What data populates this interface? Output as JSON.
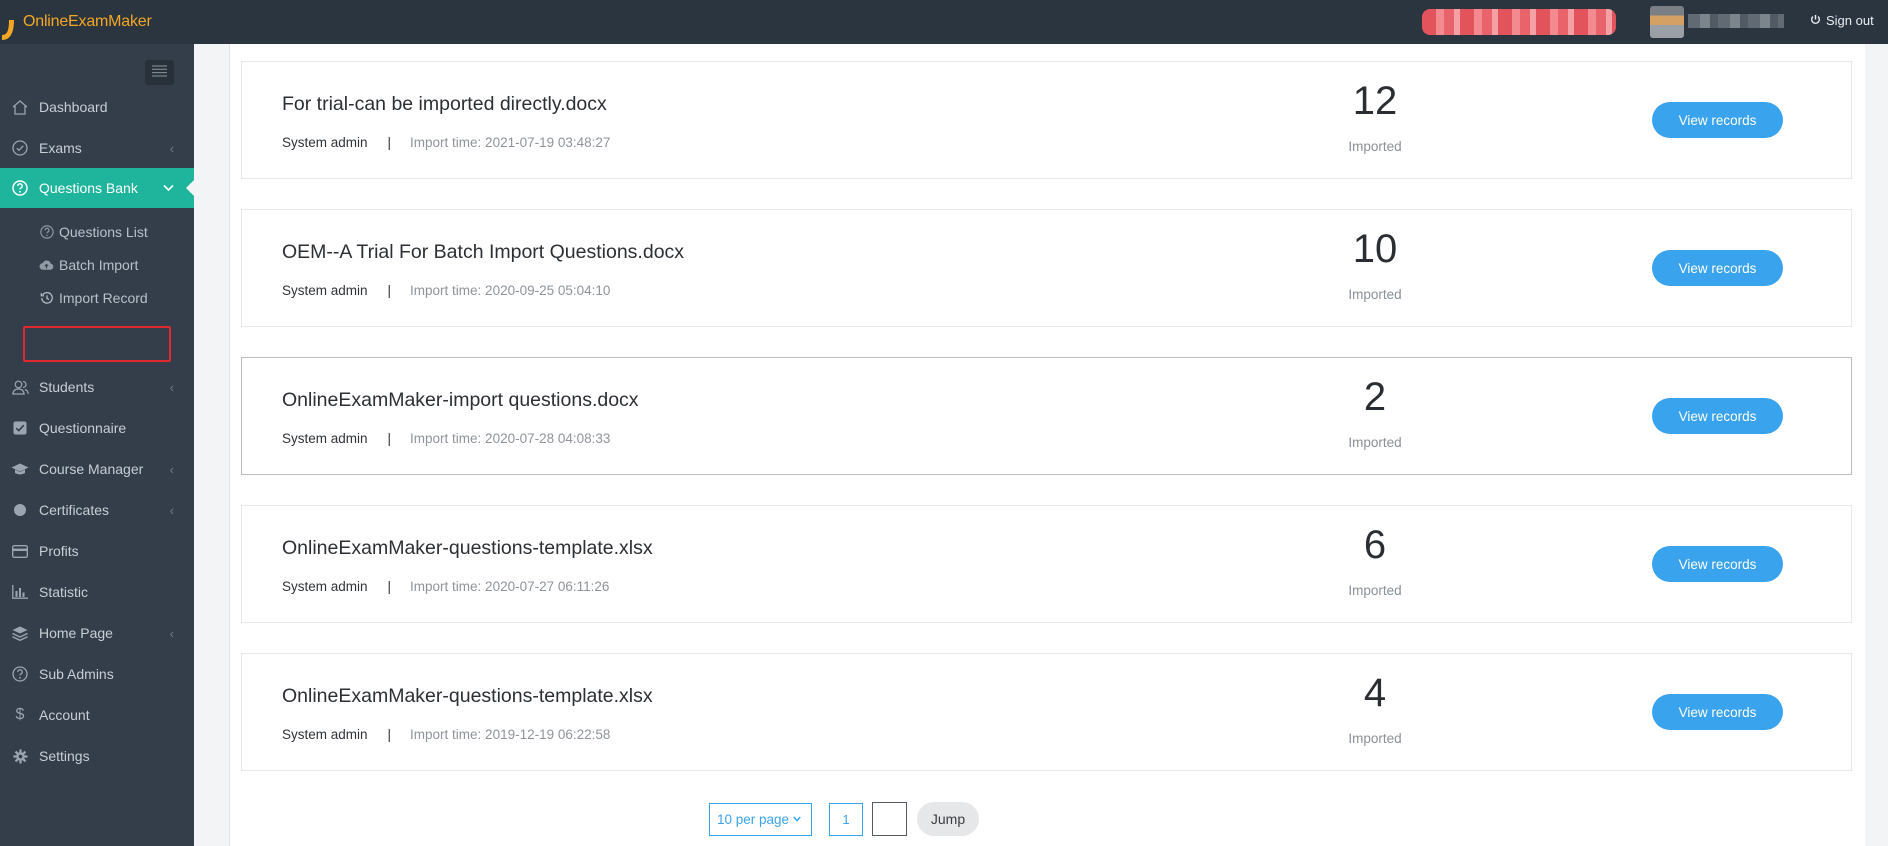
{
  "app": {
    "logo_text": "OnlineExamMaker"
  },
  "header": {
    "sign_out_label": "Sign out"
  },
  "sidebar": {
    "items": [
      {
        "label": "Dashboard",
        "icon": "home-icon"
      },
      {
        "label": "Exams",
        "icon": "check-circle-icon",
        "has_arrow": true
      },
      {
        "label": "Questions Bank",
        "icon": "question-circle-icon",
        "has_arrow": true,
        "active": true
      },
      {
        "label": "Students",
        "icon": "users-icon",
        "has_arrow": true
      },
      {
        "label": "Questionnaire",
        "icon": "checkbox-icon"
      },
      {
        "label": "Course Manager",
        "icon": "graduation-cap-icon",
        "has_arrow": true
      },
      {
        "label": "Certificates",
        "icon": "circle-icon",
        "has_arrow": true
      },
      {
        "label": "Profits",
        "icon": "credit-card-icon"
      },
      {
        "label": "Statistic",
        "icon": "bar-chart-icon"
      },
      {
        "label": "Home Page",
        "icon": "layers-icon",
        "has_arrow": true
      },
      {
        "label": "Sub Admins",
        "icon": "question-circle-icon"
      },
      {
        "label": "Account",
        "icon": "dollar-icon"
      },
      {
        "label": "Settings",
        "icon": "gear-icon"
      }
    ],
    "sub_items": [
      {
        "label": "Questions List",
        "icon": "question-circle-icon"
      },
      {
        "label": "Batch Import",
        "icon": "cloud-upload-icon"
      },
      {
        "label": "Import Record",
        "icon": "history-icon"
      }
    ]
  },
  "records": [
    {
      "title": "For trial-can be imported directly.docx",
      "author": "System admin",
      "time": "Import time: 2021-07-19 03:48:27",
      "count": "12",
      "count_label": "Imported",
      "button": "View records"
    },
    {
      "title": "OEM--A Trial For Batch Import Questions.docx",
      "author": "System admin",
      "time": "Import time: 2020-09-25 05:04:10",
      "count": "10",
      "count_label": "Imported",
      "button": "View records"
    },
    {
      "title": "OnlineExamMaker-import questions.docx",
      "author": "System admin",
      "time": "Import time: 2020-07-28 04:08:33",
      "count": "2",
      "count_label": "Imported",
      "button": "View records"
    },
    {
      "title": "OnlineExamMaker-questions-template.xlsx",
      "author": "System admin",
      "time": "Import time: 2020-07-27 06:11:26",
      "count": "6",
      "count_label": "Imported",
      "button": "View records"
    },
    {
      "title": "OnlineExamMaker-questions-template.xlsx",
      "author": "System admin",
      "time": "Import time: 2019-12-19 06:22:58",
      "count": "4",
      "count_label": "Imported",
      "button": "View records"
    }
  ],
  "separator": "|",
  "pagination": {
    "per_page": "10 per page",
    "current_page": "1",
    "jump_label": "Jump"
  },
  "colors": {
    "topbar": "#2b3540",
    "sidebar": "#343e4a",
    "active": "#1fb49c",
    "accent": "#3aa3ee",
    "logo": "#f5a623",
    "highlight": "#e0282e"
  }
}
